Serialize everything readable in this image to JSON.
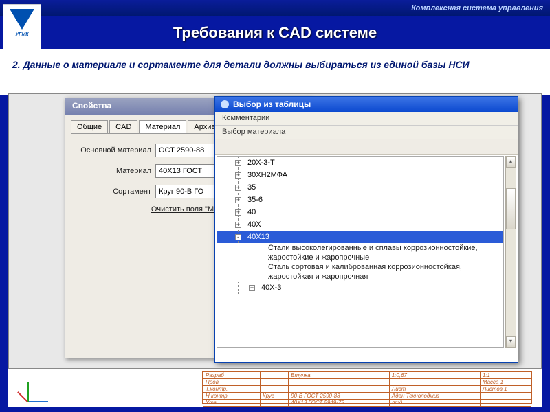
{
  "header": {
    "system_label": "Комплексная система управления",
    "logo_text": "УГМК",
    "slide_title": "Требования к CAD системе"
  },
  "subtitle": "2. Данные о материале и сортаменте для детали должны выбираться из единой базы НСИ",
  "props_dialog": {
    "title": "Свойства",
    "tabs": [
      "Общие",
      "CAD",
      "Материал",
      "Архив: $V"
    ],
    "active_tab": 2,
    "fields": {
      "osn_label": "Основной материал",
      "osn_value": "ОСТ 2590-88",
      "mat_label": "Материал",
      "mat_value": "40Х13 ГОСТ",
      "sort_label": "Сортамент",
      "sort_value": "Круг 90-В ГО"
    },
    "clear_link": "Очистить поля \"Мате"
  },
  "picker_dialog": {
    "title": "Выбор из таблицы",
    "menu": "Комментарии",
    "sub": "Выбор материала",
    "tree": [
      {
        "label": "20Х-3-Т",
        "exp": "+"
      },
      {
        "label": "30ХН2МФА",
        "exp": "+"
      },
      {
        "label": "35",
        "exp": "+"
      },
      {
        "label": "35-6",
        "exp": "+"
      },
      {
        "label": "40",
        "exp": "+"
      },
      {
        "label": "40Х",
        "exp": "+"
      },
      {
        "label": "40Х13",
        "exp": "-",
        "selected": true
      },
      {
        "label": "40Х-3",
        "exp": "+"
      }
    ],
    "children": [
      "Стали высоколегированные и сплавы коррозионностойкие, жаростойкие и жаропрочные",
      "Сталь сортовая и калиброванная коррозионностойкая, жаростойкая и жаропрочная"
    ]
  },
  "cad_block": {
    "rows": [
      [
        "Разраб",
        "",
        "",
        "Втулка",
        "1:0,67",
        "1:1"
      ],
      [
        "Пров",
        "",
        "",
        "",
        "",
        "Масса 1"
      ],
      [
        "Т.контр.",
        "",
        "",
        "",
        "Лист",
        "Листов 1"
      ],
      [
        "Н.контр.",
        "",
        "Круг",
        "90-В ГОСТ 2590-88",
        "Аден Технолоджиз",
        ""
      ],
      [
        "Утв",
        "",
        "",
        "40Х13 ГОСТ 5949-75",
        "лтд",
        ""
      ]
    ]
  }
}
